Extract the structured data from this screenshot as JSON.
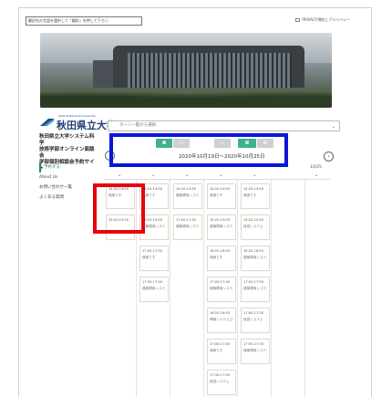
{
  "header": {
    "translate_text": "翻訳先の言語を選択して「翻訳」を押して下さい",
    "privacy_link": "PRIVACY規約とプライバシー"
  },
  "university": {
    "english_name": "Akita Prefectural University",
    "name": "秋田県立大学",
    "site_title_lines": [
      "秋田県立大学システム科学",
      "技術学部オンライン面談会",
      "学部個別相談会予約サイト"
    ]
  },
  "nav": {
    "items": [
      {
        "label": "予約する",
        "active": true
      },
      {
        "label": "About Us",
        "active": false
      },
      {
        "label": "お問い合わせ一覧",
        "active": false
      },
      {
        "label": "よくある質問",
        "active": false
      }
    ]
  },
  "course_select": {
    "placeholder": "ターン一覧から選択"
  },
  "calendar": {
    "date_range": "2020年10月19日〜2020年10月25日",
    "last_column_date": "10/25",
    "columns": [
      {
        "slots": [
          {
            "time": "14:20-14:50",
            "status": "満席です"
          },
          {
            "time": "15:20-15:50",
            "status": ""
          }
        ]
      },
      {
        "slots": [
          {
            "time": "14:20-14:50",
            "status": "満席です"
          },
          {
            "time": "15:20-15:50",
            "status": "建築環境システム"
          },
          {
            "time": "17:00-17:30",
            "status": "満席です"
          },
          {
            "time": "17:30-17:30",
            "status": "建築環境システム"
          }
        ]
      },
      {
        "slots": [
          {
            "time": "14:20-14:50",
            "status": "建築環境システム"
          },
          {
            "time": "17:00-17:30",
            "status": "建築環境システム"
          }
        ]
      },
      {
        "slots": [
          {
            "time": "14:20-14:50",
            "status": "満席です"
          },
          {
            "time": "15:20-15:50",
            "status": "建築環境システム"
          },
          {
            "time": "16:20-16:50",
            "status": "満席です"
          },
          {
            "time": "17:00-17:30",
            "status": "建築環境システム"
          },
          {
            "time": "16:20-16:50",
            "status": "情報システム工学"
          },
          {
            "time": "17:00-17:30",
            "status": "満席です"
          },
          {
            "time": "17:30-17:30",
            "status": "経営システム"
          }
        ]
      },
      {
        "slots": [
          {
            "time": "14:20-14:50",
            "status": "満席です"
          },
          {
            "time": "15:20-15:50",
            "status": "経営システム"
          },
          {
            "time": "16:20-16:50",
            "status": "建築環境システム"
          },
          {
            "time": "17:00-17:30",
            "status": "建築環境システム"
          },
          {
            "time": "17:00-17:30",
            "status": "経営システム"
          },
          {
            "time": "17:00-17:30",
            "status": "建築環境システム"
          }
        ]
      }
    ]
  },
  "colors": {
    "accent_green": "#3fb090",
    "annotation_blue": "#0a16d6",
    "annotation_red": "#e8000b",
    "university_blue": "#1f3f7a"
  }
}
